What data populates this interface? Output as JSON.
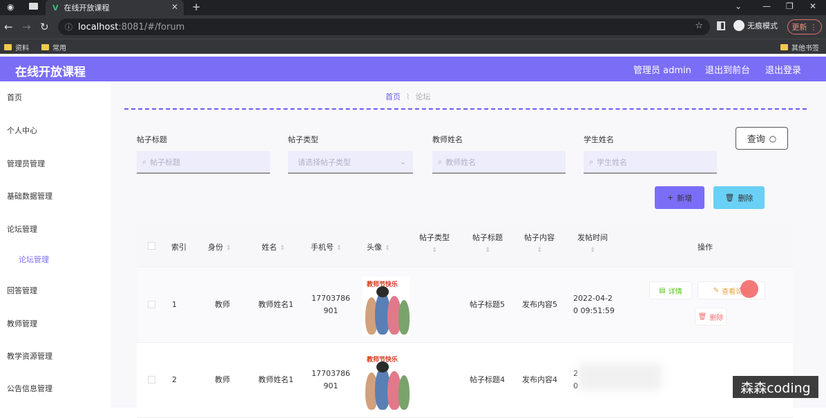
{
  "browser": {
    "tab_title": "在线开放课程",
    "url_host": "localhost",
    "url_path": ":8081/#/forum",
    "incognito_label": "无痕模式",
    "update_label": "更新",
    "bookmarks": [
      "资料",
      "常用"
    ],
    "other_bookmarks": "其他书签"
  },
  "header": {
    "app_title": "在线开放课程",
    "admin_label": "管理员 admin",
    "back_front_label": "退出到前台",
    "logout_label": "退出登录"
  },
  "sidebar": {
    "items": [
      {
        "label": "首页"
      },
      {
        "label": "个人中心"
      },
      {
        "label": "管理员管理"
      },
      {
        "label": "基础数据管理"
      },
      {
        "label": "论坛管理"
      },
      {
        "label": "论坛管理"
      },
      {
        "label": "回答管理"
      },
      {
        "label": "教师管理"
      },
      {
        "label": "教学资源管理"
      },
      {
        "label": "公告信息管理"
      }
    ]
  },
  "breadcrumb": {
    "home": "首页",
    "current": "论坛"
  },
  "filters": {
    "title_label": "帖子标题",
    "title_placeholder": "帖子标题",
    "type_label": "帖子类型",
    "type_placeholder": "请选择帖子类型",
    "teacher_label": "教师姓名",
    "teacher_placeholder": "教师姓名",
    "student_label": "学生姓名",
    "student_placeholder": "学生姓名",
    "query_label": "查询"
  },
  "actions": {
    "add_label": "新增",
    "delete_label": "删除"
  },
  "table": {
    "headers": [
      "索引",
      "身份",
      "姓名",
      "手机号",
      "头像",
      "帖子类型",
      "帖子标题",
      "帖子内容",
      "发帖时间",
      "操作"
    ],
    "rows": [
      {
        "index": "1",
        "identity": "教师",
        "name": "教师姓名1",
        "phone_a": "17703786",
        "phone_b": "901",
        "type": "",
        "title": "帖子标题5",
        "content": "发布内容5",
        "time_a": "2022-04-2",
        "time_b": "0 09:51:59"
      },
      {
        "index": "2",
        "identity": "教师",
        "name": "教师姓名1",
        "phone_a": "17703786",
        "phone_b": "901",
        "type": "",
        "title": "帖子标题4",
        "content": "发布内容4",
        "time_a": "2",
        "time_b": "0"
      }
    ],
    "avatar_text": "教师节快乐",
    "row_actions": {
      "detail": "详情",
      "view_forum": "查看论坛",
      "delete": "删除"
    }
  },
  "watermark": "森森coding",
  "colors": {
    "accent": "#7b6ef6",
    "cyan": "#6ad0f5",
    "success": "#52c41a",
    "warning": "#e6a23c",
    "danger": "#f56c6c"
  }
}
